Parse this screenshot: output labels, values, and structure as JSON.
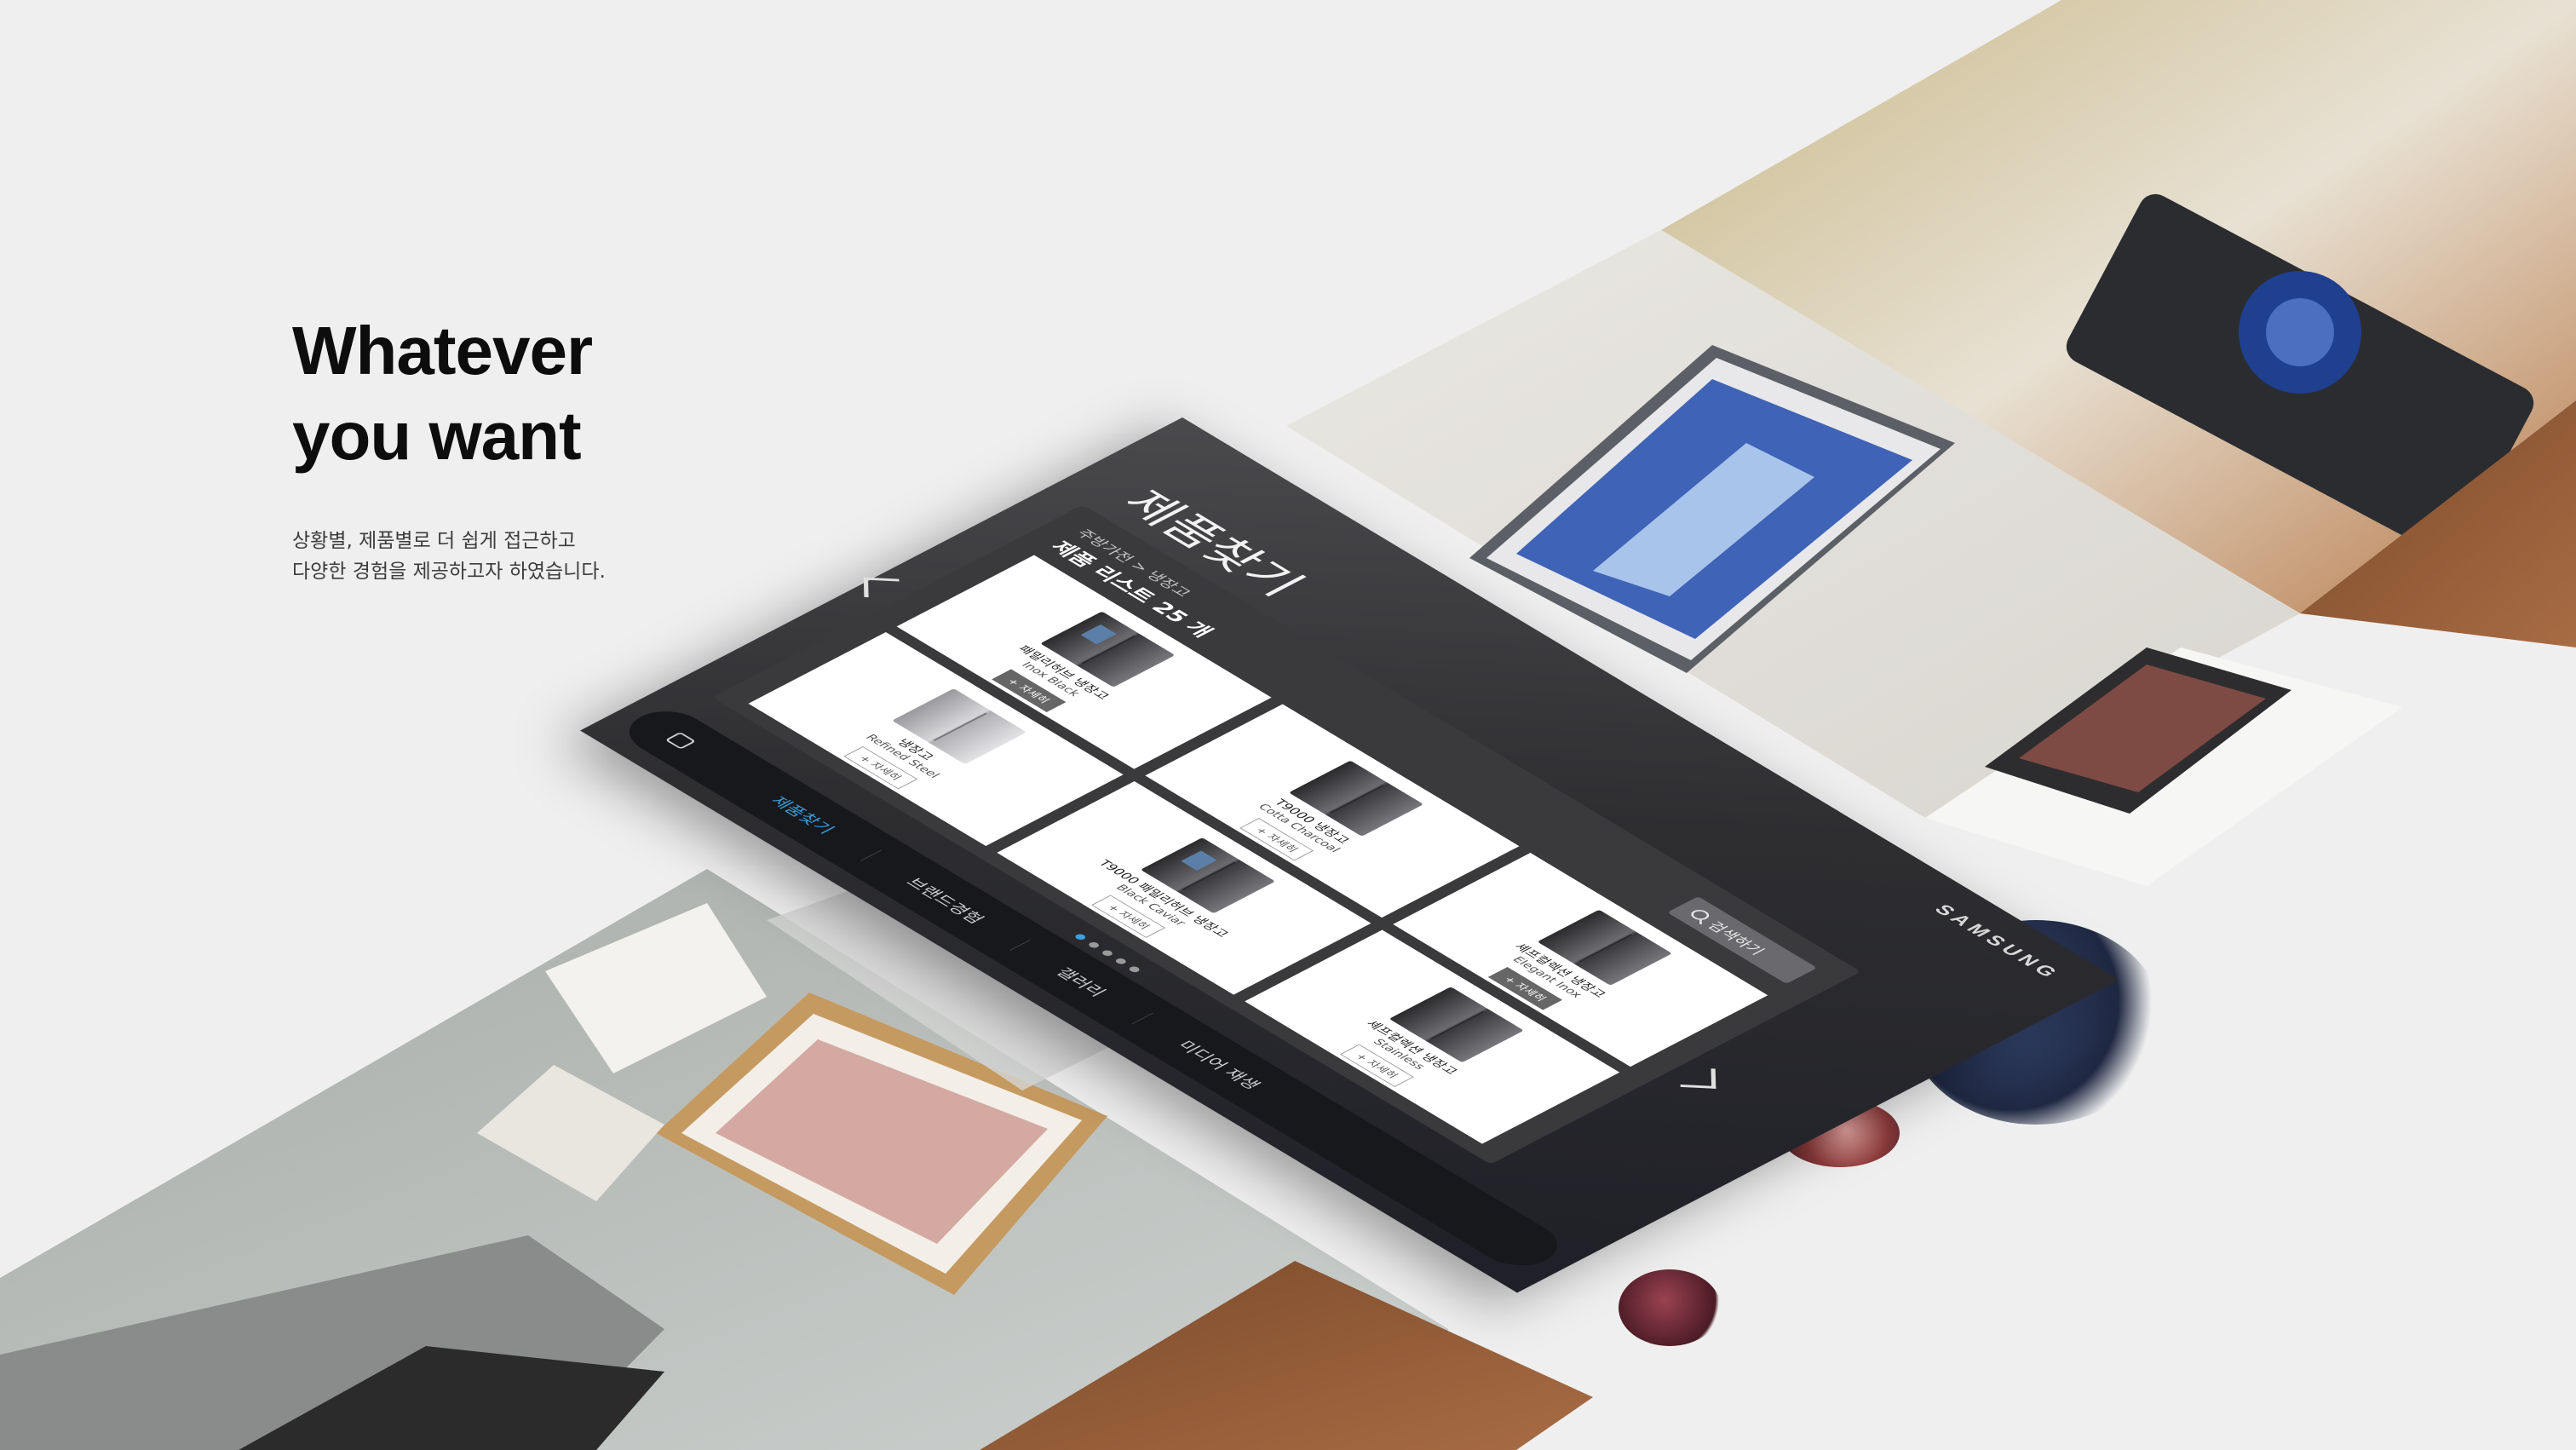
{
  "headline": {
    "line1": "Whatever",
    "line2": "you want"
  },
  "subcopy": {
    "line1": "상황별, 제품별로 더 쉽게 접근하고",
    "line2": "다양한 경험을 제공하고자 하였습니다."
  },
  "tablet": {
    "brand": "SAMSUNG",
    "page_title": "제품찾기",
    "breadcrumb": "주방가전 > 냉장고",
    "list_title": "제품 리스트 25 개",
    "search_label": "검색하기",
    "products": [
      {
        "name": "패밀리허브 냉장고",
        "color": "Inox Black",
        "button": "+ 자세히"
      },
      {
        "name": "T9000 냉장고",
        "color": "Cotta Charcoal",
        "button": "+ 자세히"
      },
      {
        "name": "셰프컬렉션 냉장고",
        "color": "Elegant Inox",
        "button": "+ 자세히"
      },
      {
        "name": "냉장고",
        "color": "Refined Steel",
        "button": "+ 자세히"
      },
      {
        "name": "T9000 패밀리허브 냉장고",
        "color": "Black Caviar",
        "button": "+ 자세히"
      },
      {
        "name": "셰프컬렉션 냉장고",
        "color": "Stainless",
        "button": "+ 자세히"
      }
    ],
    "nav": [
      "제품찾기",
      "브랜드경험",
      "갤러리",
      "미디어 재생"
    ],
    "pager_count": 5,
    "pager_active": 0
  },
  "colors": {
    "accent": "#3aa0e0",
    "background": "#efefef",
    "tablet": "#2e2e31"
  }
}
